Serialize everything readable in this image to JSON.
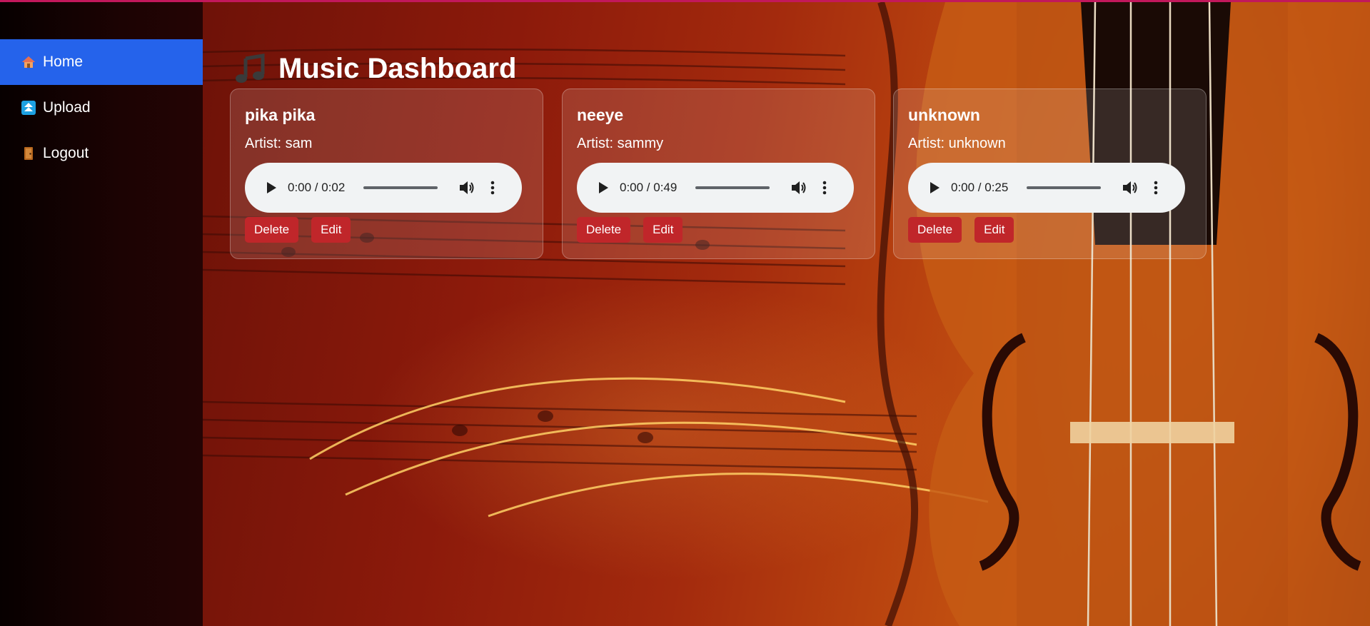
{
  "app": {
    "title": "Music Dashboard"
  },
  "colors": {
    "accent": "#2563eb",
    "danger_button": "#c0262a",
    "top_border": "#c2185b"
  },
  "sidebar": {
    "items": [
      {
        "label": "Home",
        "icon": "house-icon",
        "active": true
      },
      {
        "label": "Upload",
        "icon": "upload-icon",
        "active": false
      },
      {
        "label": "Logout",
        "icon": "door-icon",
        "active": false
      }
    ]
  },
  "songs": [
    {
      "title": "pika pika",
      "artist": "Artist: sam",
      "time": "0:00 / 0:02",
      "delete_label": "Delete",
      "edit_label": "Edit"
    },
    {
      "title": "neeye",
      "artist": "Artist: sammy",
      "time": "0:00 / 0:49",
      "delete_label": "Delete",
      "edit_label": "Edit"
    },
    {
      "title": "unknown",
      "artist": "Artist: unknown",
      "time": "0:00 / 0:25",
      "delete_label": "Delete",
      "edit_label": "Edit"
    }
  ]
}
